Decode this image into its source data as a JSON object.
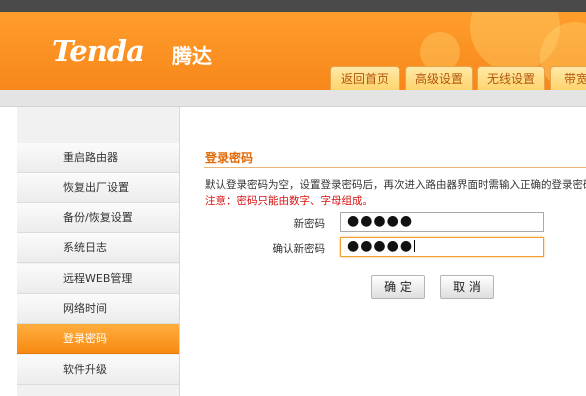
{
  "brand": {
    "logo_en": "Tenda",
    "logo_cn": "腾达"
  },
  "nav_tabs": [
    {
      "label": "返回首页"
    },
    {
      "label": "高级设置"
    },
    {
      "label": "无线设置"
    },
    {
      "label": "带宽"
    }
  ],
  "sidebar": {
    "active": "登录密码",
    "items": [
      {
        "label": "重启路由器"
      },
      {
        "label": "恢复出厂设置"
      },
      {
        "label": "备份/恢复设置"
      },
      {
        "label": "系统日志"
      },
      {
        "label": "远程WEB管理"
      },
      {
        "label": "网络时间"
      },
      {
        "label": "登录密码"
      },
      {
        "label": "软件升级"
      }
    ]
  },
  "main": {
    "title": "登录密码",
    "description": "默认登录密码为空，设置登录密码后，再次进入路由器界面时需输入正确的登录密码。",
    "note": "注意：密码只能由数字、字母组成。",
    "new_password_label": "新密码",
    "new_password_value": "●●●●●",
    "confirm_password_label": "确认新密码",
    "confirm_password_value": "●●●●●",
    "ok_button": "确 定",
    "cancel_button": "取 消"
  },
  "colors": {
    "accent": "#f7871a",
    "active_item": "#f78a12",
    "note_red": "#d90f0f"
  }
}
